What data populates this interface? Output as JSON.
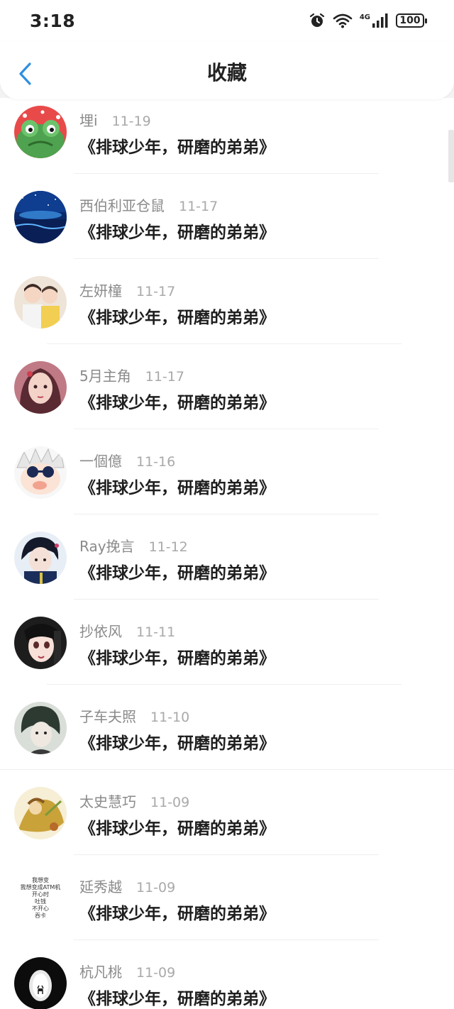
{
  "status_bar": {
    "time": "3:18",
    "network": "4G",
    "battery": "100"
  },
  "header": {
    "title": "收藏"
  },
  "items": [
    {
      "username": "埋i",
      "date": "11-19",
      "title": "《排球少年，研磨的弟弟》"
    },
    {
      "username": "西伯利亚仓鼠",
      "date": "11-17",
      "title": "《排球少年，研磨的弟弟》"
    },
    {
      "username": "左妍橦",
      "date": "11-17",
      "title": "《排球少年，研磨的弟弟》"
    },
    {
      "username": "5月主角",
      "date": "11-17",
      "title": "《排球少年，研磨的弟弟》"
    },
    {
      "username": "一個億",
      "date": "11-16",
      "title": "《排球少年，研磨的弟弟》"
    },
    {
      "username": "Ray挽言",
      "date": "11-12",
      "title": "《排球少年，研磨的弟弟》"
    },
    {
      "username": "抄依风",
      "date": "11-11",
      "title": "《排球少年，研磨的弟弟》"
    },
    {
      "username": "子车夫照",
      "date": "11-10",
      "title": "《排球少年，研磨的弟弟》"
    },
    {
      "username": "太史慧巧",
      "date": "11-09",
      "title": "《排球少年，研磨的弟弟》"
    },
    {
      "username": "延秀越",
      "date": "11-09",
      "title": "《排球少年，研磨的弟弟》",
      "avatar_text": [
        "我想变",
        "我想变成ATM机",
        "开心时",
        "吐钱",
        "不开心",
        "吞卡"
      ]
    },
    {
      "username": "杭凡桃",
      "date": "11-09",
      "title": "《排球少年，研磨的弟弟》"
    }
  ]
}
